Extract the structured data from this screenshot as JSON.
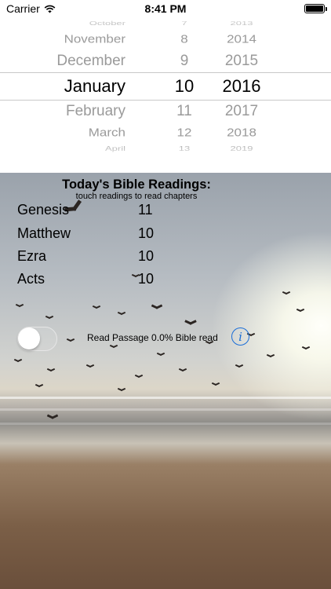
{
  "status_bar": {
    "carrier": "Carrier",
    "time": "8:41 PM"
  },
  "picker": {
    "rows": [
      {
        "month": "October",
        "day": "7",
        "year": "2013"
      },
      {
        "month": "November",
        "day": "8",
        "year": "2014"
      },
      {
        "month": "December",
        "day": "9",
        "year": "2015"
      },
      {
        "month": "January",
        "day": "10",
        "year": "2016"
      },
      {
        "month": "February",
        "day": "11",
        "year": "2017"
      },
      {
        "month": "March",
        "day": "12",
        "year": "2018"
      },
      {
        "month": "April",
        "day": "13",
        "year": "2019"
      }
    ]
  },
  "readings": {
    "title": "Today's Bible Readings:",
    "subtitle": "touch readings to read chapters",
    "items": [
      {
        "book": "Genesis",
        "chapter": "11"
      },
      {
        "book": "Matthew",
        "chapter": "10"
      },
      {
        "book": "Ezra",
        "chapter": "10"
      },
      {
        "book": "Acts",
        "chapter": "10"
      }
    ]
  },
  "progress": {
    "label": "Read Passage 0.0% Bible read",
    "read_passage_on": false
  },
  "info_icon": "info-icon",
  "colors": {
    "accent": "#1a6ed8"
  }
}
